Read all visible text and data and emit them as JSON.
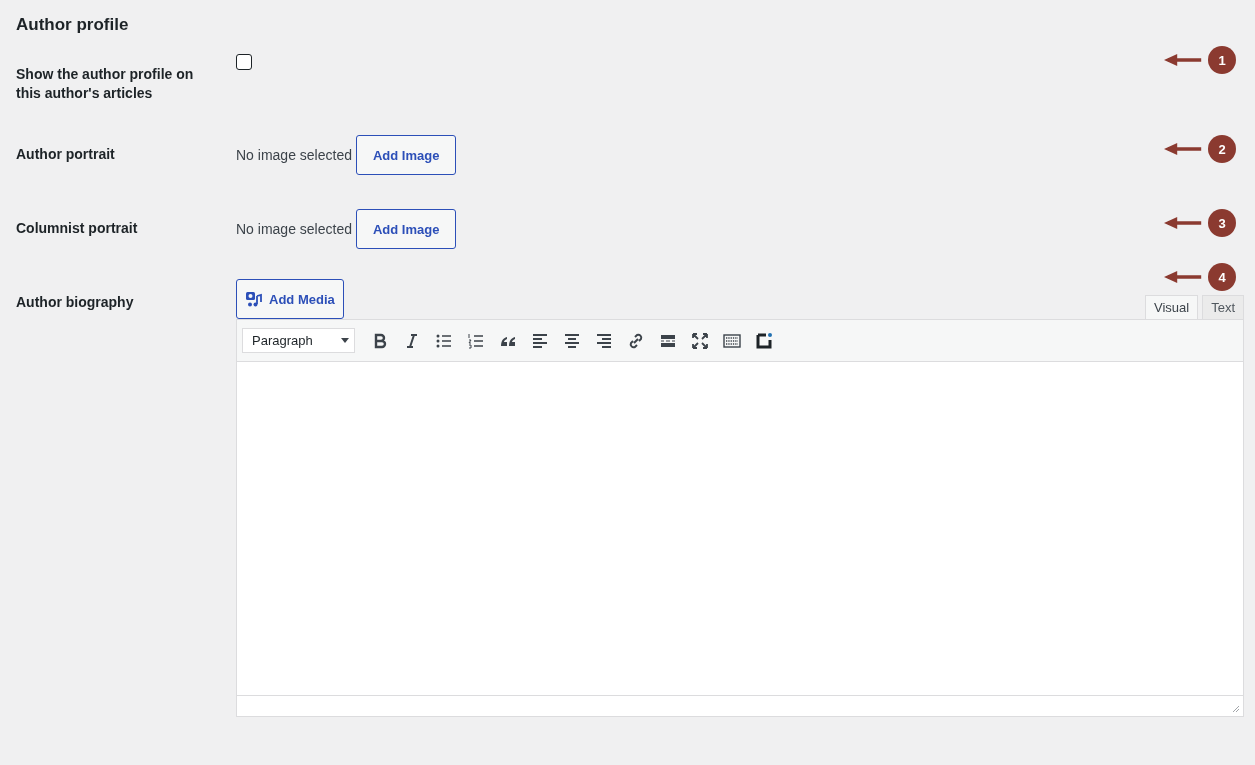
{
  "heading": "Author profile",
  "rows": [
    {
      "kind": "checkbox",
      "label": "Show the author profile on this author's articles",
      "checked": false,
      "callout": "1"
    },
    {
      "kind": "image",
      "label": "Author portrait",
      "status": "No image selected",
      "button": "Add Image",
      "callout": "2"
    },
    {
      "kind": "image",
      "label": "Columnist portrait",
      "status": "No image selected",
      "button": "Add Image",
      "callout": "3"
    },
    {
      "kind": "editor",
      "label": "Author biography",
      "media_button": "Add Media",
      "tabs": [
        {
          "label": "Visual",
          "selected": true
        },
        {
          "label": "Text",
          "selected": false
        }
      ],
      "format": "Paragraph",
      "callout": "4"
    }
  ]
}
